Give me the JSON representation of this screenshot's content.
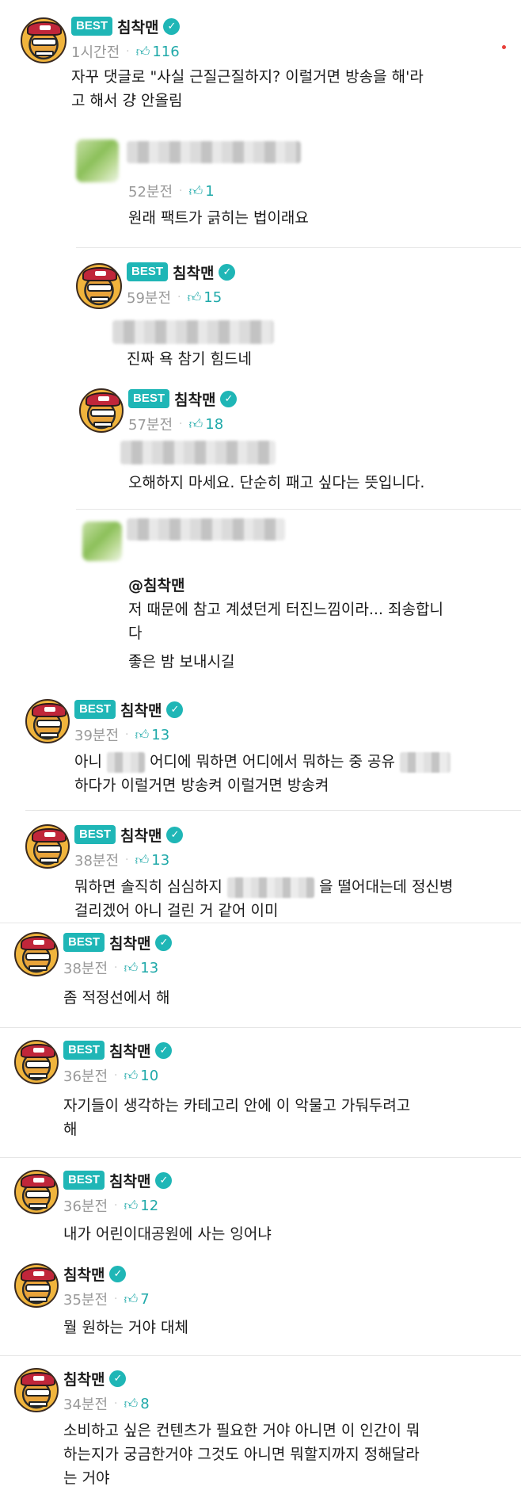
{
  "author": "침착맨",
  "best_label": "BEST",
  "verified_mark": "✓",
  "like_icon": "thumbs-up-icon",
  "accent_color": "#1fb6b6",
  "comments": [
    {
      "time": "1시간전",
      "likes": "116",
      "lines": [
        "자꾸 댓글로 \"사실 근질근질하지? 이럴거면 방송을 해'라",
        "고 해서 걍 안올림"
      ]
    },
    {
      "time": "52분전",
      "likes": "1",
      "lines": [
        "원래 팩트가 긁히는 법이래요"
      ]
    },
    {
      "time": "59분전",
      "likes": "15",
      "lines": [
        "진짜 욕 참기 힘드네"
      ]
    },
    {
      "time": "57분전",
      "likes": "18",
      "lines": [
        "오해하지 마세요. 단순히 패고 싶다는 뜻입니다."
      ]
    },
    {
      "mention": "@침착맨",
      "lines": [
        "저 때문에 참고 계셨던게 터진느낌이라... 죄송합니",
        "다",
        "좋은 밤 보내시길"
      ]
    },
    {
      "time": "39분전",
      "likes": "13",
      "seg": [
        "아니",
        "어디에 뭐하면 어디에서 뭐하는 중 공유"
      ],
      "line2": "하다가 이럴거면 방송켜 이럴거면 방송켜"
    },
    {
      "time": "38분전",
      "likes": "13",
      "seg": [
        "뭐하면 솔직히 심심하지",
        "을 떨어대는데 정신병"
      ],
      "line2": "걸리겠어 아니 걸린 거 같어 이미"
    },
    {
      "time": "38분전",
      "likes": "13",
      "lines": [
        "좀 적정선에서 해"
      ]
    },
    {
      "time": "36분전",
      "likes": "10",
      "lines": [
        "자기들이 생각하는 카테고리 안에 이 악물고 가둬두려고",
        "해"
      ]
    },
    {
      "time": "36분전",
      "likes": "12",
      "lines": [
        "내가 어린이대공원에 사는 잉어냐"
      ]
    },
    {
      "time": "35분전",
      "likes": "7",
      "lines": [
        "뭘 원하는 거야 대체"
      ]
    },
    {
      "time": "34분전",
      "likes": "8",
      "lines": [
        "소비하고 싶은 컨텐츠가 필요한 거야 아니면 이 인간이 뭐",
        "하는지가 궁금한거야 그것도 아니면 뭐할지까지 정해달라",
        "는 거야"
      ]
    }
  ]
}
